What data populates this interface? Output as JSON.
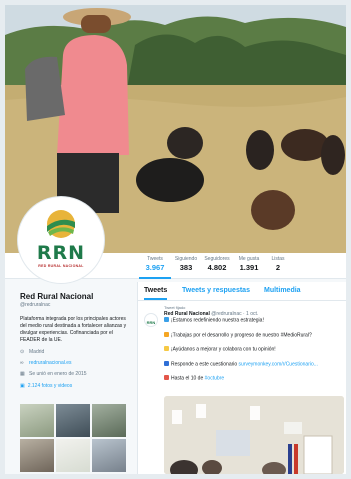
{
  "stats": [
    {
      "label": "Tweets",
      "value": "3.967"
    },
    {
      "label": "Siguiendo",
      "value": "383"
    },
    {
      "label": "Seguidores",
      "value": "4.802"
    },
    {
      "label": "Me gusta",
      "value": "1.391"
    },
    {
      "label": "Listas",
      "value": "2"
    }
  ],
  "avatar": {
    "logo_text": "RRN",
    "subtitle": "RED RURAL NACIONAL"
  },
  "profile": {
    "name": "Red Rural Nacional",
    "handle": "@redruralnac",
    "bio": "Plataforma integrada por los principales actores del medio rural destinada a fortalecer alianzas y divulgar experiencias. Cofinanciada por el FEADER de la UE.",
    "location": "Madrid",
    "website": "redruralnacional.es",
    "joined": "Se unió en enero de 2015",
    "photos_link": "2.124 fotos y videos"
  },
  "timeline": {
    "tabs": [
      "Tweets",
      "Tweets y respuestas",
      "Multimedia"
    ],
    "pinned_label": "Tweet fijado",
    "tweet": {
      "author": "Red Rural Nacional",
      "meta": "@redruralnac · 1 oct.",
      "lines": [
        "¡Estamos redefiniendo nuestra estrategia!",
        "¡Trabajas por el desarrollo y progreso de nuestro #MedioRural?",
        "¡Ayúdanos a mejorar y colabora con tu opinión!",
        "Responde a este cuestionario",
        "surveymonkey.com/r/Cuestionario...",
        "Hasta el 10 de",
        "#octubre"
      ]
    }
  },
  "colors": {
    "accent": "#1da1f2",
    "brand_green": "#1f7a4a",
    "brand_red": "#b52b2b"
  }
}
